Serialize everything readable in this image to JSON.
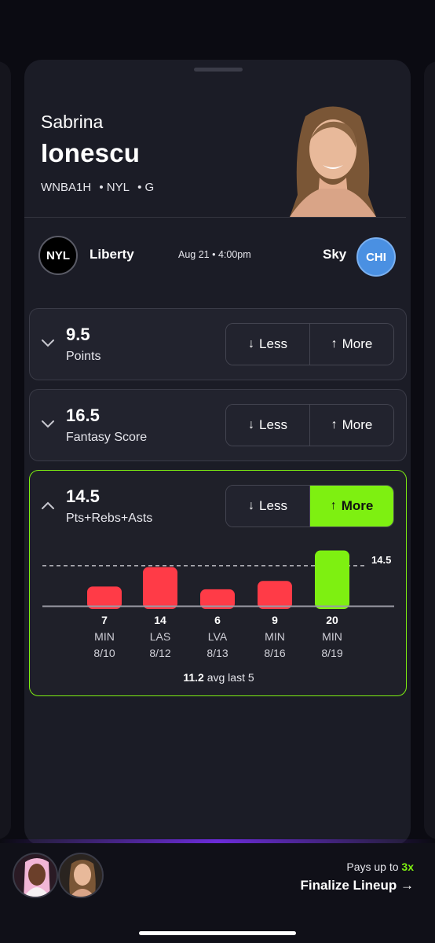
{
  "player": {
    "first_name": "Sabrina",
    "last_name": "Ionescu",
    "league": "WNBA1H",
    "team": "• NYL",
    "position": "• G"
  },
  "game": {
    "home_abbr": "NYL",
    "home_name": "Liberty",
    "time": "Aug 21 • 4:00pm",
    "away_name": "Sky",
    "away_abbr": "CHI",
    "away_color": "#4a90e2"
  },
  "props": [
    {
      "line": "9.5",
      "stat": "Points",
      "less": "Less",
      "more": "More",
      "expanded": false
    },
    {
      "line": "16.5",
      "stat": "Fantasy Score",
      "less": "Less",
      "more": "More",
      "expanded": false
    },
    {
      "line": "14.5",
      "stat": "Pts+Rebs+Asts",
      "less": "Less",
      "more": "More",
      "expanded": true,
      "selected": "More"
    }
  ],
  "chart_data": {
    "type": "bar",
    "threshold": 14.5,
    "threshold_label": "14.5",
    "categories": [
      "8/10",
      "8/12",
      "8/13",
      "8/16",
      "8/19"
    ],
    "opponents": [
      "MIN",
      "LAS",
      "LVA",
      "MIN",
      "MIN"
    ],
    "values": [
      7,
      14,
      6,
      9,
      20
    ],
    "colors": {
      "under": "#ff3b47",
      "over": "#7ef011"
    },
    "avg_value": "11.2",
    "avg_text": "avg last 5"
  },
  "footer": {
    "pays_prefix": "Pays up to ",
    "pays_mult": "3x",
    "finalize": "Finalize Lineup →"
  },
  "colors": {
    "accent": "#7ef011",
    "background": "#1b1c26"
  }
}
